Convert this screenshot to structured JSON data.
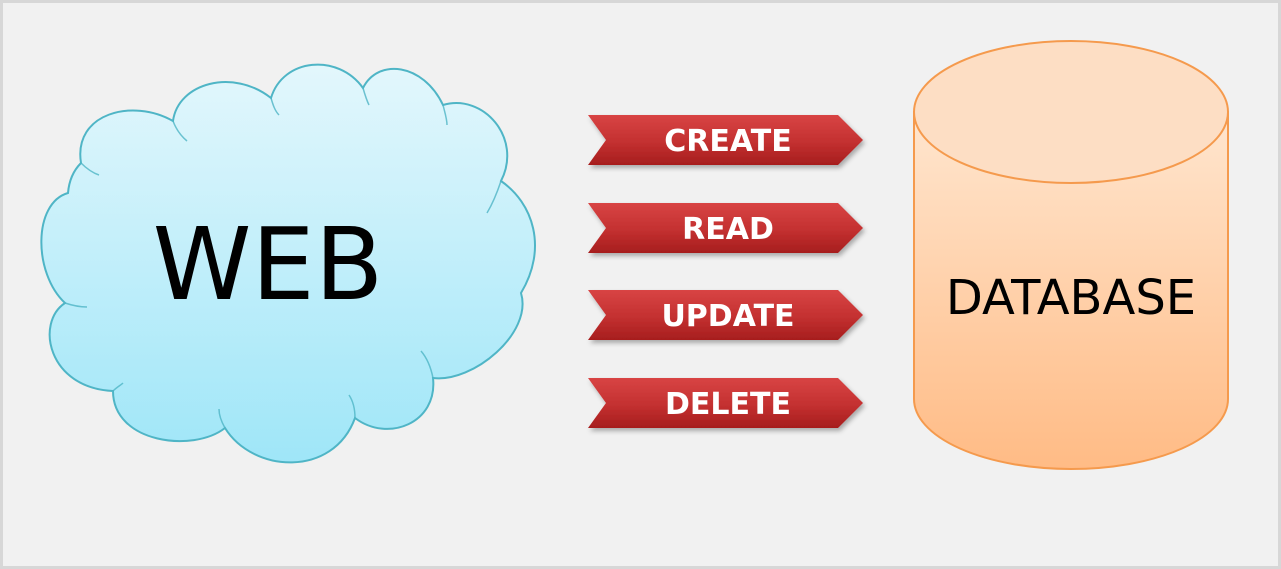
{
  "cloud": {
    "label": "WEB"
  },
  "database": {
    "label": "DATABASE"
  },
  "operations": [
    {
      "label": "CREATE"
    },
    {
      "label": "READ"
    },
    {
      "label": "UPDATE"
    },
    {
      "label": "DELETE"
    }
  ],
  "colors": {
    "background": "#f1f1f1",
    "cloud_fill_top": "#e3f7fc",
    "cloud_fill_bottom": "#9fe6f8",
    "cloud_stroke": "#4fb5c6",
    "arrow_fill_top": "#d84444",
    "arrow_fill_bottom": "#a61e1e",
    "cylinder_fill_top": "#ffe6cf",
    "cylinder_fill_bottom": "#ffbb85",
    "cylinder_stroke": "#f59a4d"
  },
  "icons": [
    "cloud-shape",
    "cylinder-shape",
    "chevron-arrow"
  ]
}
